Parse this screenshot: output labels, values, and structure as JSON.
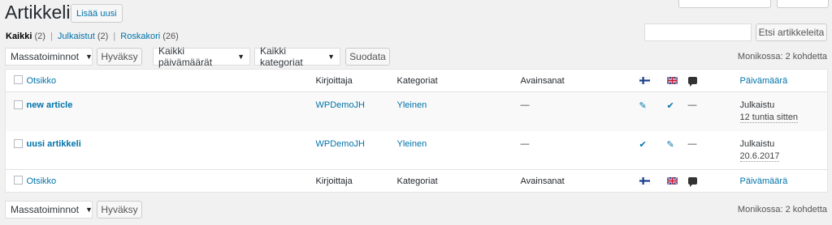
{
  "header": {
    "title": "Artikkelit",
    "add_new": "Lisää uusi"
  },
  "views": [
    {
      "label": "Kaikki",
      "count": "(2)"
    },
    {
      "label": "Julkaistut",
      "count": "(2)"
    },
    {
      "label": "Roskakori",
      "count": "(26)"
    }
  ],
  "search": {
    "button": "Etsi artikkeleita",
    "value": ""
  },
  "filters": {
    "bulk": "Massatoiminnot",
    "apply": "Hyväksy",
    "dates": "Kaikki päivämäärät",
    "categories": "Kaikki kategoriat",
    "filter": "Suodata"
  },
  "count_text": "Monikossa: 2 kohdetta",
  "columns": {
    "title": "Otsikko",
    "author": "Kirjoittaja",
    "categories": "Kategoriat",
    "tags": "Avainsanat",
    "date": "Päivämäärä"
  },
  "rows": [
    {
      "title": "new article",
      "author": "WPDemoJH",
      "category": "Yleinen",
      "tags": "—",
      "fi": "edit",
      "en": "check",
      "comments": "—",
      "status": "Julkaistu",
      "date": "12 tuntia sitten"
    },
    {
      "title": "uusi artikkeli",
      "author": "WPDemoJH",
      "category": "Yleinen",
      "tags": "—",
      "fi": "check",
      "en": "edit",
      "comments": "—",
      "status": "Julkaistu",
      "date": "20.6.2017"
    }
  ],
  "colors": {
    "link": "#0073aa",
    "background": "#f1f1f1"
  }
}
